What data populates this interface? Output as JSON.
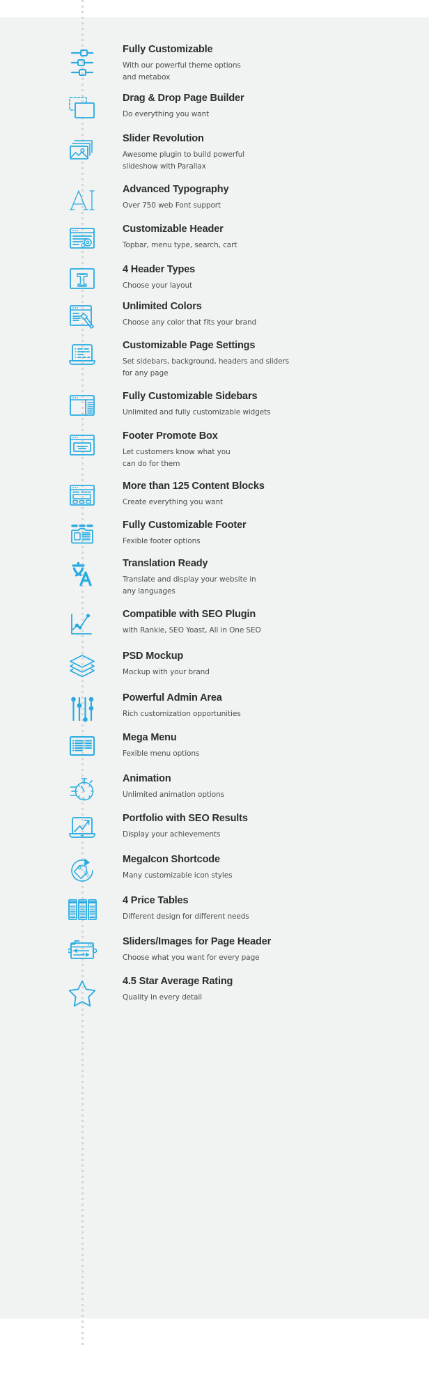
{
  "theme": {
    "accent_color": "#29abe2",
    "panel_background": "#f1f3f2",
    "page_background": "#ffffff",
    "title_color": "#2b2d2e",
    "description_color": "#4a4d4f",
    "timeline_color": "#d4d4d4"
  },
  "features": [
    {
      "icon": "sliders-settings-icon",
      "title": "Fully Customizable",
      "desc_lines": [
        "With our powerful theme options",
        "and metabox"
      ]
    },
    {
      "icon": "drag-drop-page-builder-icon",
      "title": "Drag & Drop Page Builder",
      "desc_lines": [
        "Do everything you want"
      ]
    },
    {
      "icon": "image-stack-slider-icon",
      "title": "Slider Revolution",
      "desc_lines": [
        "Awesome plugin to build powerful",
        "slideshow with Parallax"
      ]
    },
    {
      "icon": "typography-serif-ai-icon",
      "title": "Advanced Typography",
      "desc_lines": [
        "Over 750 web Font support"
      ]
    },
    {
      "icon": "browser-gear-header-icon",
      "title": "Customizable Header",
      "desc_lines": [
        "Topbar, menu type, search, cart"
      ]
    },
    {
      "icon": "letter-t-box-icon",
      "title": "4 Header Types",
      "desc_lines": [
        "Choose your layout"
      ]
    },
    {
      "icon": "browser-paintbrush-icon",
      "title": "Unlimited Colors",
      "desc_lines": [
        "Choose any color that fits your brand"
      ]
    },
    {
      "icon": "laptop-settings-list-icon",
      "title": "Customizable Page Settings",
      "desc_lines": [
        "Set sidebars, background, headers and sliders",
        "for any page"
      ]
    },
    {
      "icon": "browser-sidebar-icon",
      "title": "Fully Customizable Sidebars",
      "desc_lines": [
        "Unlimited and fully customizable widgets"
      ]
    },
    {
      "icon": "browser-promo-box-icon",
      "title": "Footer Promote Box",
      "desc_lines": [
        "Let customers know what you",
        "can do for them"
      ]
    },
    {
      "icon": "content-blocks-grid-icon",
      "title": "More than 125 Content Blocks",
      "desc_lines": [
        "Create everything you want"
      ]
    },
    {
      "icon": "footer-layout-icon",
      "title": "Fully Customizable Footer",
      "desc_lines": [
        "Fexible footer options"
      ]
    },
    {
      "icon": "translate-language-icon",
      "title": "Translation Ready",
      "desc_lines": [
        "Translate and display your website in",
        "any languages"
      ]
    },
    {
      "icon": "seo-line-chart-icon",
      "title": "Compatible with SEO Plugin",
      "desc_lines": [
        "with Rankie, SEO Yoast, All in One SEO"
      ]
    },
    {
      "icon": "layers-psd-icon",
      "title": "PSD Mockup",
      "desc_lines": [
        "Mockup with your brand"
      ]
    },
    {
      "icon": "admin-sliders-icon",
      "title": "Powerful Admin Area",
      "desc_lines": [
        "Rich customization opportunities"
      ]
    },
    {
      "icon": "mega-menu-list-icon",
      "title": "Mega Menu",
      "desc_lines": [
        "Fexible menu options"
      ]
    },
    {
      "icon": "stopwatch-animation-icon",
      "title": "Animation",
      "desc_lines": [
        "Unlimited animation options"
      ]
    },
    {
      "icon": "laptop-growth-chart-icon",
      "title": "Portfolio with SEO Results",
      "desc_lines": [
        "Display your achievements"
      ]
    },
    {
      "icon": "seo-tag-circle-icon",
      "title": "MegaIcon Shortcode",
      "desc_lines": [
        "Many customizable icon styles"
      ]
    },
    {
      "icon": "price-tables-columns-icon",
      "title": "4 Price Tables",
      "desc_lines": [
        "Different design for different needs"
      ]
    },
    {
      "icon": "page-header-slider-icon",
      "title": "Sliders/Images for Page Header",
      "desc_lines": [
        "Choose what you want for every page"
      ]
    },
    {
      "icon": "star-rating-icon",
      "title": "4.5 Star Average Rating",
      "desc_lines": [
        "Quality in every detail"
      ]
    }
  ]
}
